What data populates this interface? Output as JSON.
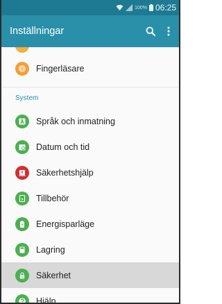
{
  "status_bar": {
    "battery_percent": "100%",
    "time": "06:25"
  },
  "app_bar": {
    "title": "Inställningar",
    "search_icon": "search-icon",
    "more_icon": "more-vert-icon"
  },
  "top_item": {
    "label": "Fingerläsare",
    "icon_color": "#f2a03a"
  },
  "section": {
    "header": "System"
  },
  "items": [
    {
      "label": "Språk och inmatning",
      "icon": "keyboard-icon",
      "color": "#4caf50"
    },
    {
      "label": "Datum och tid",
      "icon": "calendar-icon",
      "color": "#4caf50"
    },
    {
      "label": "Säkerhetshjälp",
      "icon": "alert-icon",
      "color": "#d32f2f"
    },
    {
      "label": "Tillbehör",
      "icon": "accessory-icon",
      "color": "#4caf50"
    },
    {
      "label": "Energisparläge",
      "icon": "battery-icon",
      "color": "#4caf50"
    },
    {
      "label": "Lagring",
      "icon": "storage-icon",
      "color": "#4caf50"
    },
    {
      "label": "Säkerhet",
      "icon": "lock-icon",
      "color": "#4caf50",
      "selected": true
    },
    {
      "label": "Hjälp",
      "icon": "help-icon",
      "color": "#4caf50"
    }
  ],
  "colors": {
    "accent": "#2a8fa9",
    "status_bar": "#1e7a92",
    "selected_row": "#d8d8d8"
  }
}
